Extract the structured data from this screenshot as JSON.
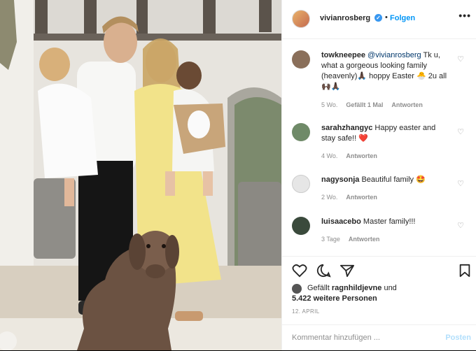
{
  "header": {
    "username": "vivianrosberg",
    "follow_label": "Folgen",
    "more_label": "•••"
  },
  "comments": [
    {
      "user": "towkneepee",
      "mention": "@vivianrosberg",
      "text": " Tk u, what a gorgeous looking family (heavenly)🙏🏿 hoppy Easter 🐣 2u all🙌🏿🙏🏿",
      "time": "5 Wo.",
      "likes": "Gefällt 1 Mal",
      "reply": "Antworten",
      "avatar_color": "#8a6f5a"
    },
    {
      "user": "sarahzhangyc",
      "text": " Happy easter and stay safe!! ❤️",
      "time": "4 Wo.",
      "reply": "Antworten",
      "avatar_color": "#6f8a68"
    },
    {
      "user": "nagysonja",
      "text": " Beautiful family 🤩",
      "time": "2 Wo.",
      "reply": "Antworten",
      "avatar_color": "#e6e6e6"
    },
    {
      "user": "luisaacebo",
      "text": " Master family!!!",
      "time": "3 Tage",
      "reply": "Antworten",
      "avatar_color": "#3a4a3c"
    }
  ],
  "likes": {
    "line1_prefix": "Gefällt ",
    "line1_user": "ragnhildjevne",
    "line1_suffix": " und",
    "line2": "5.422 weitere Personen"
  },
  "date": "12. APRIL",
  "add_comment": {
    "placeholder": "Kommentar hinzufügen ...",
    "post_label": "Posten"
  },
  "icons": [
    "heart-icon",
    "comment-icon",
    "share-icon",
    "bookmark-icon"
  ]
}
